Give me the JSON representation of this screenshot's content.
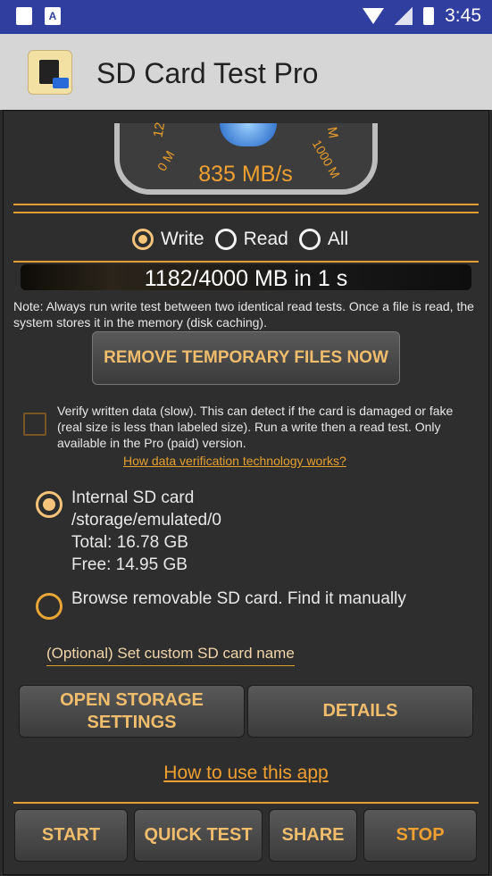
{
  "status_bar": {
    "time": "3:45",
    "icons": [
      "sd-card-icon",
      "text-a-icon",
      "wifi-icon",
      "no-signal-icon",
      "battery-charging-icon"
    ]
  },
  "app_bar": {
    "title": "SD Card Test Pro"
  },
  "gauge": {
    "speed": "835 MB/s",
    "tick_left": "12",
    "tick_left2": "0 M",
    "tick_right": "M",
    "tick_right2": "1000 M"
  },
  "mode": {
    "options": [
      "Write",
      "Read",
      "All"
    ],
    "selected": "Write"
  },
  "progress": {
    "text": "1182/4000 MB in 1 s"
  },
  "note": "Note: Always run write test between two identical read tests. Once a file is read, the system stores it in the memory (disk caching).",
  "buttons": {
    "remove_temp": "REMOVE TEMPORARY FILES NOW",
    "open_storage": "OPEN STORAGE SETTINGS",
    "details": "DETAILS",
    "start": "START",
    "quick_test": "QUICK TEST",
    "share": "SHARE",
    "stop": "STOP"
  },
  "verify": {
    "checked": false,
    "text": "Verify written data (slow). This can detect if the card is damaged or fake (real size is less than labeled size). Run a write then a read test. Only available in the Pro (paid) version.",
    "link": "How data verification technology works?"
  },
  "storage": {
    "internal": {
      "title": "Internal SD card",
      "path": "/storage/emulated/0",
      "total": "Total: 16.78 GB",
      "free": "Free: 14.95 GB",
      "selected": true
    },
    "removable": {
      "label": "Browse removable SD card. Find it manually",
      "selected": false
    }
  },
  "custom_name": "(Optional) Set custom SD card name",
  "how_to_link": "How to use this app",
  "colors": {
    "accent": "#e0a030",
    "button_text": "#f0bd6c",
    "status_bar": "#303f9f"
  }
}
